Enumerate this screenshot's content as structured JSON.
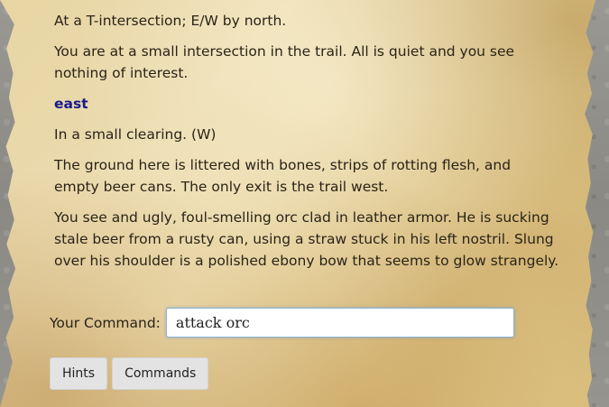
{
  "log": {
    "room1_title": "At a T-intersection; E/W by north.",
    "room1_description": "You are at a small intersection in the trail. All is quiet and you see nothing of interest.",
    "player_command": "east",
    "room2_title": "In a small clearing. (W)",
    "room2_description": "The ground here is littered with bones, strips of rotting flesh, and empty beer cans. The only exit is the trail west.",
    "room2_monster": "You see and ugly, foul-smelling orc clad in leather armor. He is sucking stale beer from a rusty can, using a straw stuck in his left nostril. Slung over his shoulder is a polished ebony bow that seems to glow strangely."
  },
  "command": {
    "label": "Your Command:",
    "value": "attack orc"
  },
  "buttons": {
    "hints": "Hints",
    "commands": "Commands"
  },
  "colors": {
    "direction_text": "#1a1a8c",
    "parchment": "#e8d6a4",
    "stone_border": "#8c8a86"
  }
}
